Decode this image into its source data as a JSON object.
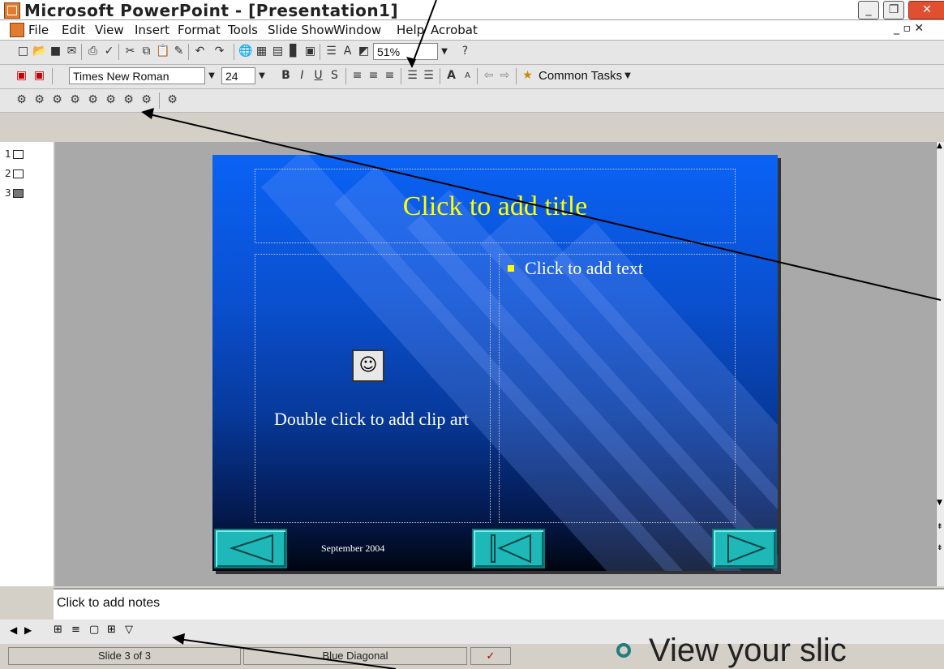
{
  "window": {
    "title": "Microsoft PowerPoint - [Presentation1]"
  },
  "menu": [
    "File",
    "Edit",
    "View",
    "Insert",
    "Format",
    "Tools",
    "Slide Show",
    "Window",
    "Help",
    "Acrobat"
  ],
  "toolbar": {
    "zoom": "51%"
  },
  "format_toolbar": {
    "font": "Times New Roman",
    "size": "24",
    "common_tasks": "Common Tasks"
  },
  "slides_pane": {
    "items": [
      "1",
      "2",
      "3"
    ]
  },
  "slide": {
    "title": "Click to add title",
    "body_text": "Click to add text",
    "clip_art_text": "Double click to add clip art",
    "date": "September 2004"
  },
  "notes": {
    "placeholder": "Click to add notes"
  },
  "status": {
    "slide": "Slide 3 of 3",
    "design": "Blue Diagonal"
  },
  "caption": {
    "text": "View your slic"
  },
  "colors": {
    "slide_top": "#0a62f4",
    "slide_bottom": "#000510",
    "title_text": "#ffff00",
    "nav_button": "#1fb8b8"
  }
}
